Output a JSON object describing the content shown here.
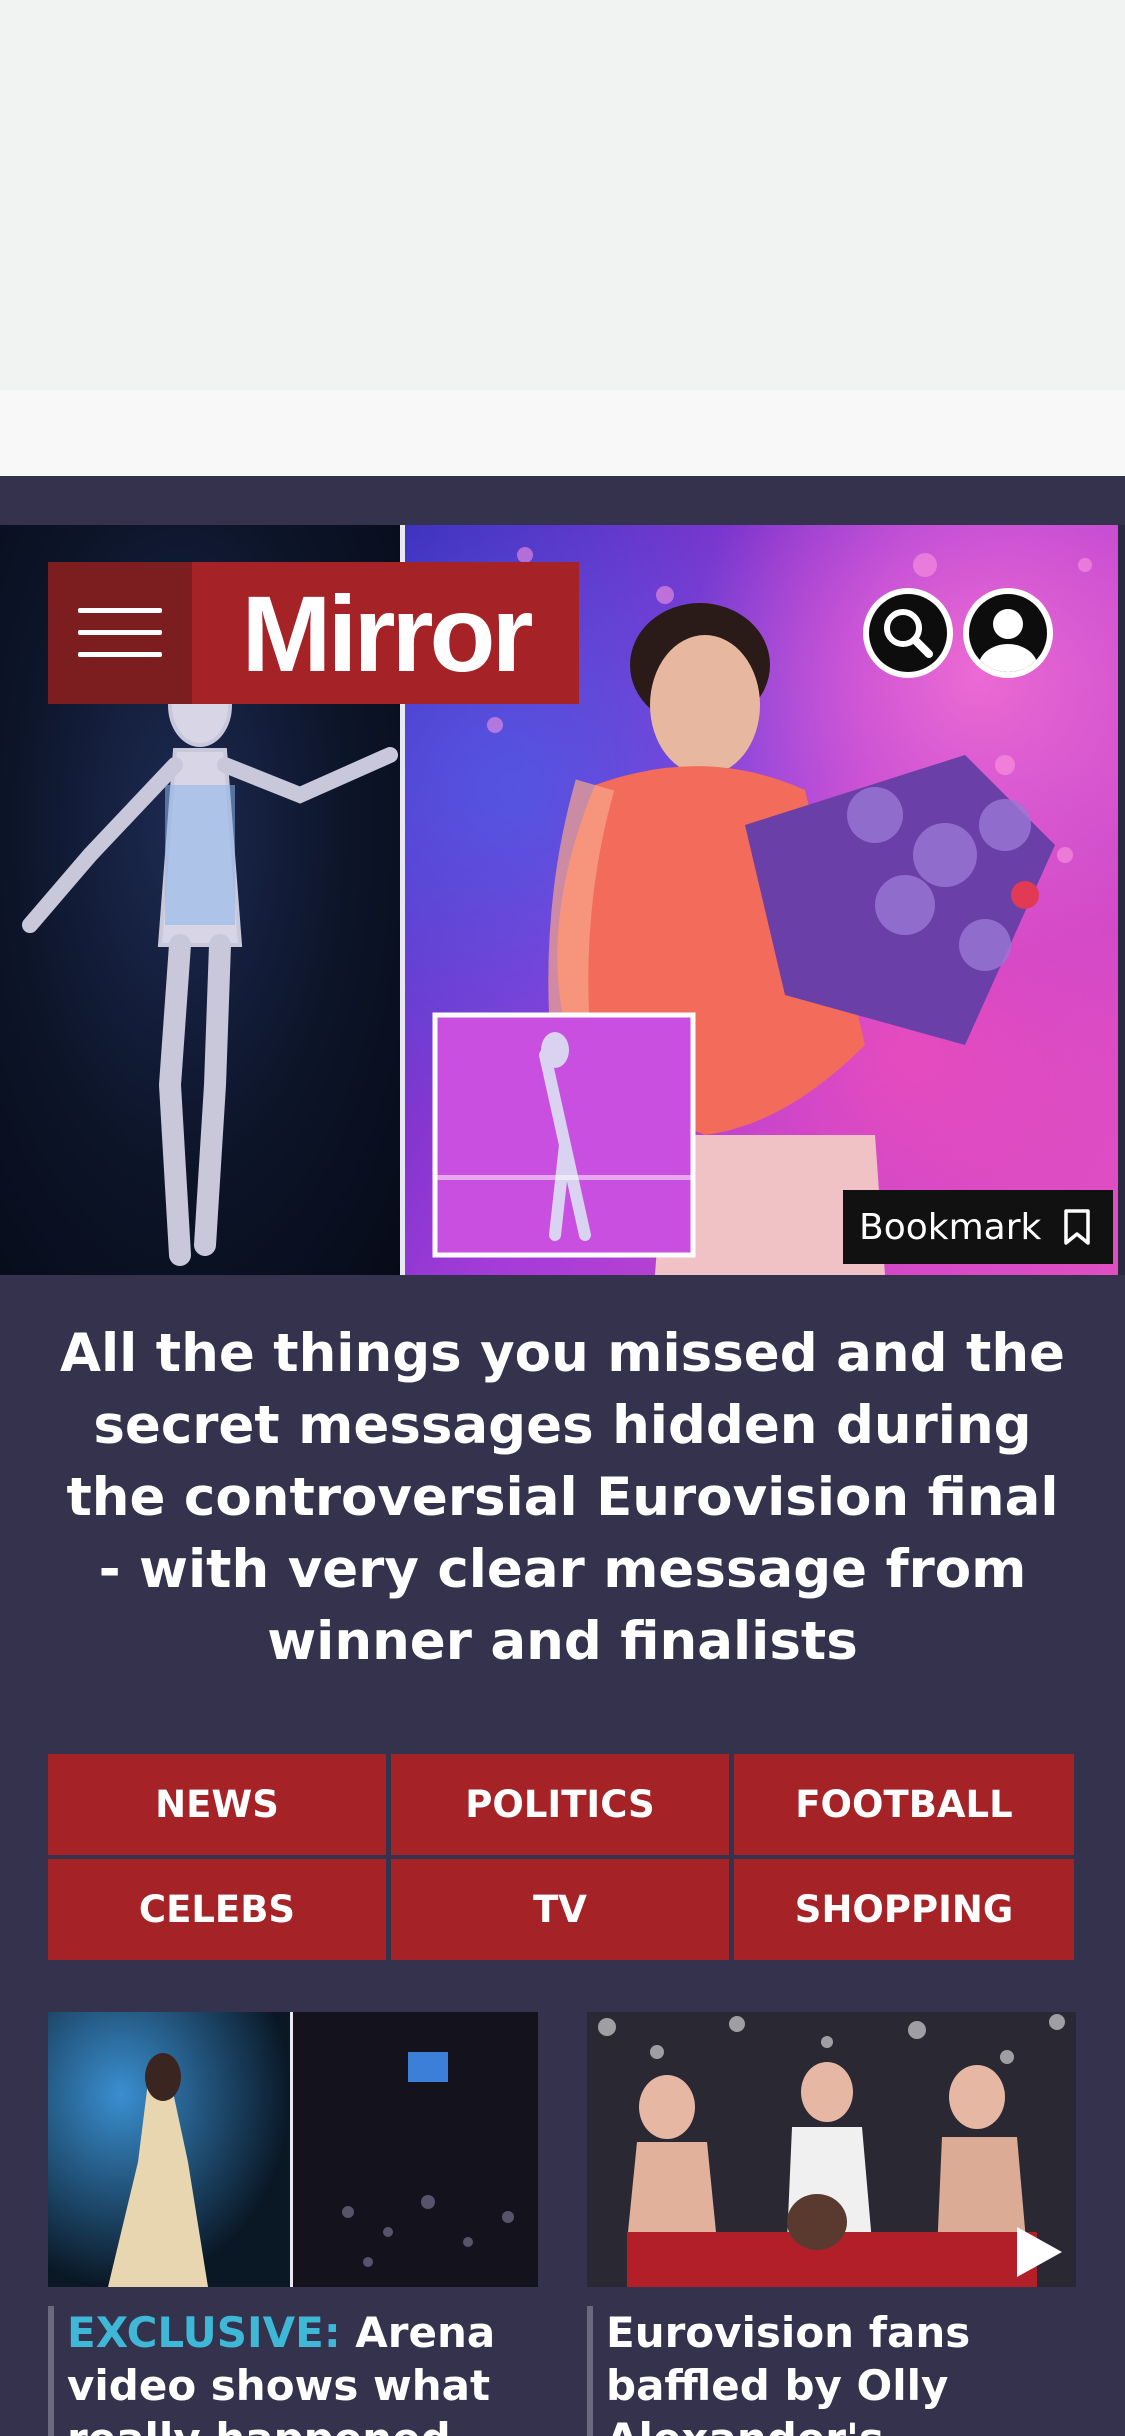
{
  "header": {
    "logo": "Mirror",
    "menu_icon": "hamburger-icon",
    "search_icon": "search-icon",
    "account_icon": "account-icon"
  },
  "hero": {
    "bookmark_label": "Bookmark",
    "bookmark_icon": "bookmark-icon"
  },
  "headline": "All the things you missed and the secret messages hidden during the controversial Eurovision final - with very clear message from winner and finalists",
  "nav": {
    "items": [
      "NEWS",
      "POLITICS",
      "FOOTBALL",
      "CELEBS",
      "TV",
      "SHOPPING"
    ]
  },
  "cards": [
    {
      "tag": "EXCLUSIVE:",
      "title": "Arena video shows what really happened with"
    },
    {
      "title": "Eurovision fans baffled by Olly Alexander's",
      "play_icon": "play-icon"
    }
  ],
  "colors": {
    "page_bg": "#34324c",
    "brand_red": "#a52327",
    "menu_dark_red": "#7c1d1f",
    "exclusive_blue": "#3fb7d6"
  }
}
